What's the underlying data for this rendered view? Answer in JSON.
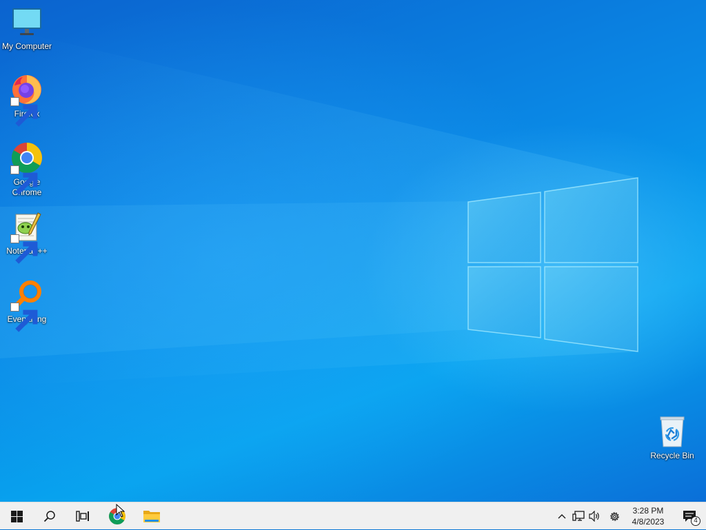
{
  "desktop": {
    "icons": [
      {
        "label": "My Computer",
        "icon": "monitor-icon",
        "shortcut": false
      },
      {
        "label": "Firefox",
        "icon": "firefox-icon",
        "shortcut": true
      },
      {
        "label": "Google Chrome",
        "icon": "chrome-icon",
        "shortcut": true
      },
      {
        "label": "Notepad++",
        "icon": "notepad-plus-plus-icon",
        "shortcut": true
      },
      {
        "label": "Everything",
        "icon": "everything-search-icon",
        "shortcut": true
      }
    ],
    "recycle_bin": {
      "label": "Recycle Bin",
      "icon": "recycle-bin-icon"
    }
  },
  "taskbar": {
    "start": {
      "icon": "windows-start-icon"
    },
    "search": {
      "icon": "search-icon"
    },
    "task_view": {
      "icon": "task-view-icon"
    },
    "pinned": [
      {
        "name": "Google Chrome",
        "icon": "chrome-icon"
      },
      {
        "name": "File Explorer",
        "icon": "folder-icon"
      }
    ],
    "tray": {
      "icons": [
        "chevron-up-icon",
        "network-icon",
        "volume-icon",
        "settings-gear-icon"
      ],
      "time": "3:28 PM",
      "date": "4/8/2023",
      "notification_count": "4"
    }
  },
  "colors": {
    "desktop_blue": "#0a78d6",
    "taskbar_bg": "#f0f0f0",
    "windows_accent": "#0078d7"
  }
}
